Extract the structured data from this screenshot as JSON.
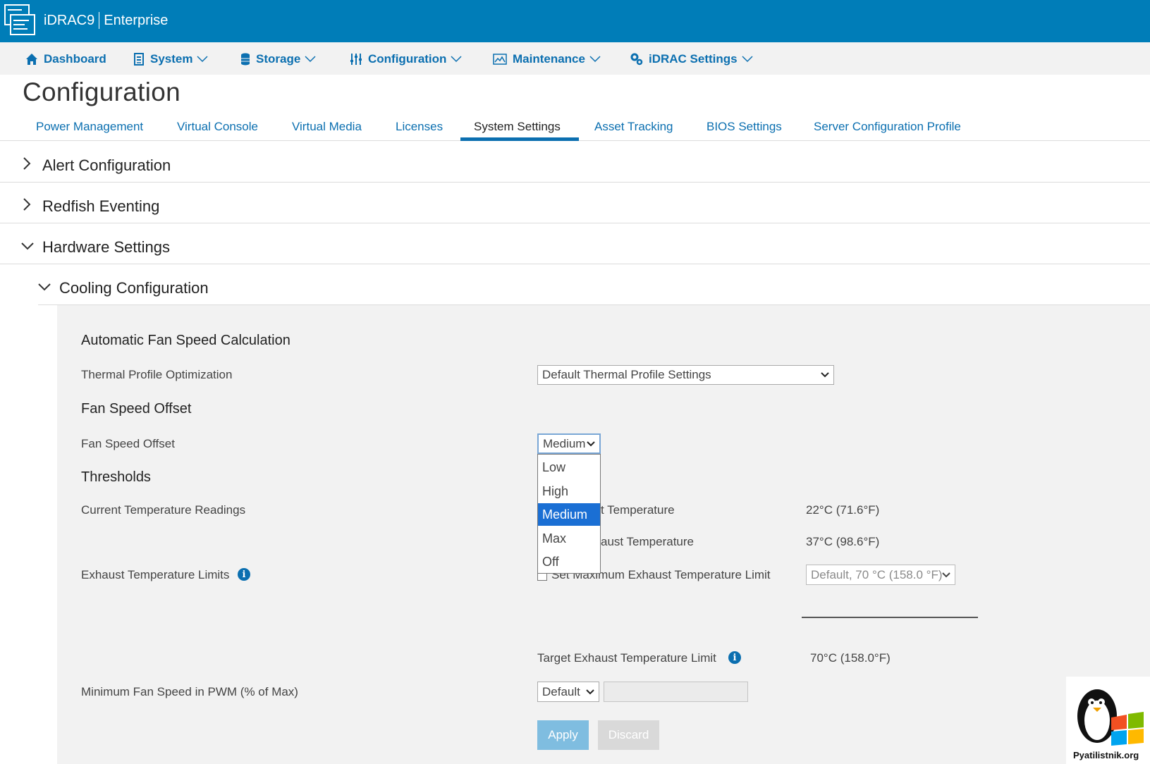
{
  "header": {
    "product": "iDRAC9",
    "edition": "Enterprise"
  },
  "nav": {
    "items": [
      {
        "label": "Dashboard",
        "icon": "home-icon"
      },
      {
        "label": "System",
        "icon": "server-icon"
      },
      {
        "label": "Storage",
        "icon": "database-icon"
      },
      {
        "label": "Configuration",
        "icon": "sliders-icon"
      },
      {
        "label": "Maintenance",
        "icon": "monitor-icon"
      },
      {
        "label": "iDRAC Settings",
        "icon": "gears-icon"
      }
    ]
  },
  "page_title": "Configuration",
  "tabs": [
    {
      "label": "Power Management"
    },
    {
      "label": "Virtual Console"
    },
    {
      "label": "Virtual Media"
    },
    {
      "label": "Licenses"
    },
    {
      "label": "System Settings",
      "active": true
    },
    {
      "label": "Asset Tracking"
    },
    {
      "label": "BIOS Settings"
    },
    {
      "label": "Server Configuration Profile"
    }
  ],
  "sections": [
    {
      "label": "Alert Configuration",
      "expanded": false
    },
    {
      "label": "Redfish Eventing",
      "expanded": false
    },
    {
      "label": "Hardware Settings",
      "expanded": true
    }
  ],
  "subsection": {
    "label": "Cooling Configuration",
    "expanded": true
  },
  "cooling": {
    "auto_heading": "Automatic Fan Speed Calculation",
    "thermal_profile_label": "Thermal Profile Optimization",
    "thermal_profile_value": "Default Thermal Profile Settings",
    "fan_offset_heading": "Fan Speed Offset",
    "fan_offset_label": "Fan Speed Offset",
    "fan_offset_value": "Medium",
    "fan_offset_options": [
      "Low",
      "High",
      "Medium",
      "Max",
      "Off"
    ],
    "fan_offset_selected": "Medium",
    "thresholds_heading": "Thresholds",
    "current_temp_label": "Current Temperature Readings",
    "inlet_label_visible": "t Temperature",
    "inlet_value": "22°C (71.6°F)",
    "exhaust_label_visible": "aust Temperature",
    "exhaust_value": "37°C (98.6°F)",
    "exhaust_limits_label": "Exhaust Temperature Limits",
    "set_max_label": "Set Maximum Exhaust Temperature Limit",
    "set_max_value": "Default, 70 °C (158.0 °F)",
    "target_label": "Target Exhaust Temperature Limit",
    "target_value": "70°C (158.0°F)",
    "min_fan_label": "Minimum Fan Speed in PWM (% of Max)",
    "min_fan_value": "Default",
    "apply_label": "Apply",
    "discard_label": "Discard"
  },
  "watermark": {
    "text": "Pyatilistnik.org"
  },
  "colors": {
    "header_bg": "#007db8",
    "link": "#0b6fb0",
    "dropdown_selected": "#1a6fd4",
    "apply_bg": "#7fbde0",
    "panel_bg": "#f2f2f2"
  }
}
